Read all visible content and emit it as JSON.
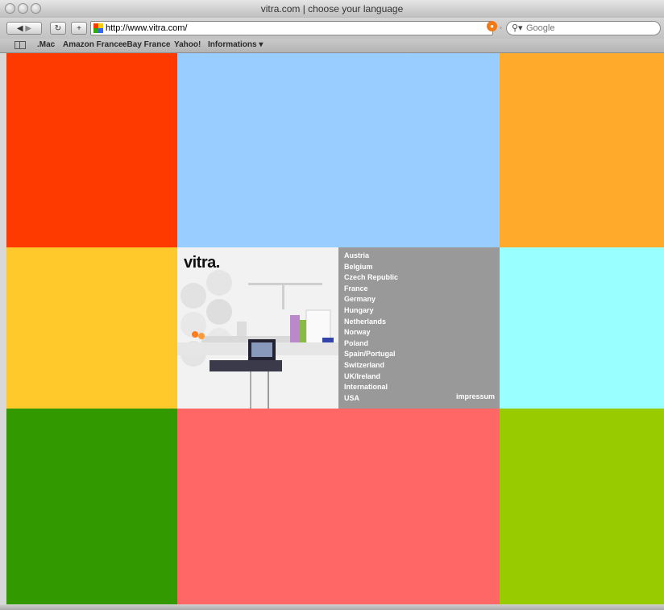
{
  "window": {
    "title": "vitra.com | choose your language"
  },
  "toolbar": {
    "url": "http://www.vitra.com/",
    "search_placeholder": "Google"
  },
  "bookmarks": [
    ".Mac",
    "Amazon France",
    "eBay France",
    "Yahoo!",
    "Informations ▾"
  ],
  "page": {
    "logo": "vitra.",
    "countries": [
      "Austria",
      "Belgium",
      "Czech Republic",
      "France",
      "Germany",
      "Hungary",
      "Netherlands",
      "Norway",
      "Poland",
      "Spain/Portugal",
      "Switzerland",
      "UK/Ireland",
      "International",
      "USA"
    ],
    "impressum": "impressum",
    "tile_colors": {
      "top_left": "#ff3a00",
      "top_middle": "#99ccff",
      "top_right": "#ffaa2a",
      "middle_left": "#ffc92c",
      "middle_right": "#99ffff",
      "bottom_left": "#339900",
      "bottom_middle": "#ff6666",
      "bottom_right": "#99cc00",
      "menu_bg": "#999999"
    }
  }
}
